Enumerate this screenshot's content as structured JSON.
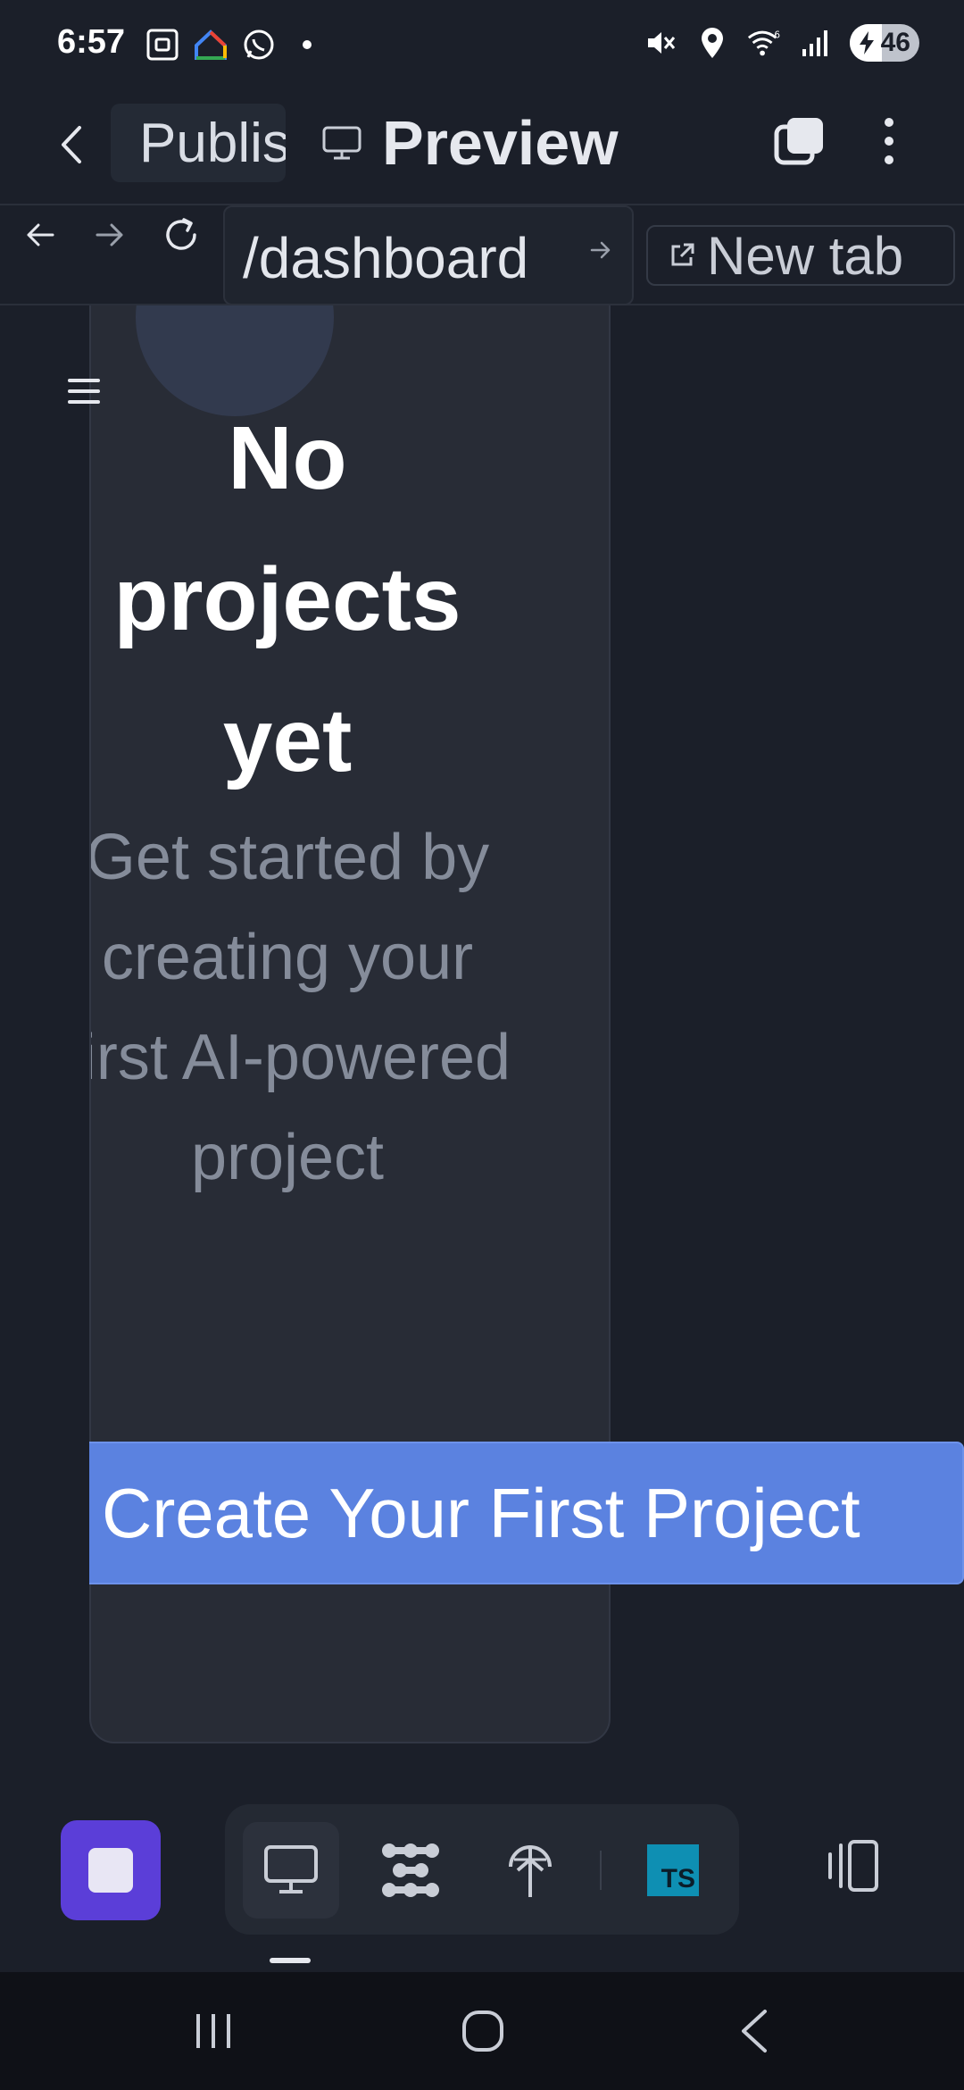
{
  "status_bar": {
    "time": "6:57",
    "battery": "46",
    "battery_level_percent": 46,
    "icons": [
      "screenshot-icon",
      "google-home-icon",
      "whatsapp-icon",
      "notification-dot-icon",
      "mute-icon",
      "location-icon",
      "wifi-icon",
      "signal-icon",
      "battery-icon"
    ]
  },
  "header": {
    "publish_tab_label": "Publish",
    "preview_tab_label": "Preview"
  },
  "browser": {
    "url": "/dashboard",
    "new_tab_label": "New tab"
  },
  "empty_state": {
    "title": "No projects yet",
    "subtitle": "Get started by creating your first AI-powered project",
    "cta_label": "Create Your First Project"
  },
  "colors": {
    "background": "#1b1f29",
    "card": "#282c36",
    "accent_blue": "#5b82e0",
    "stop_purple": "#5b3ed8",
    "typescript_teal": "#0e8fb3"
  },
  "toolbar": {
    "tools": [
      "monitor-icon",
      "nodes-icon",
      "publish-antenna-icon",
      "typescript-icon"
    ],
    "ts_label": "TS"
  }
}
